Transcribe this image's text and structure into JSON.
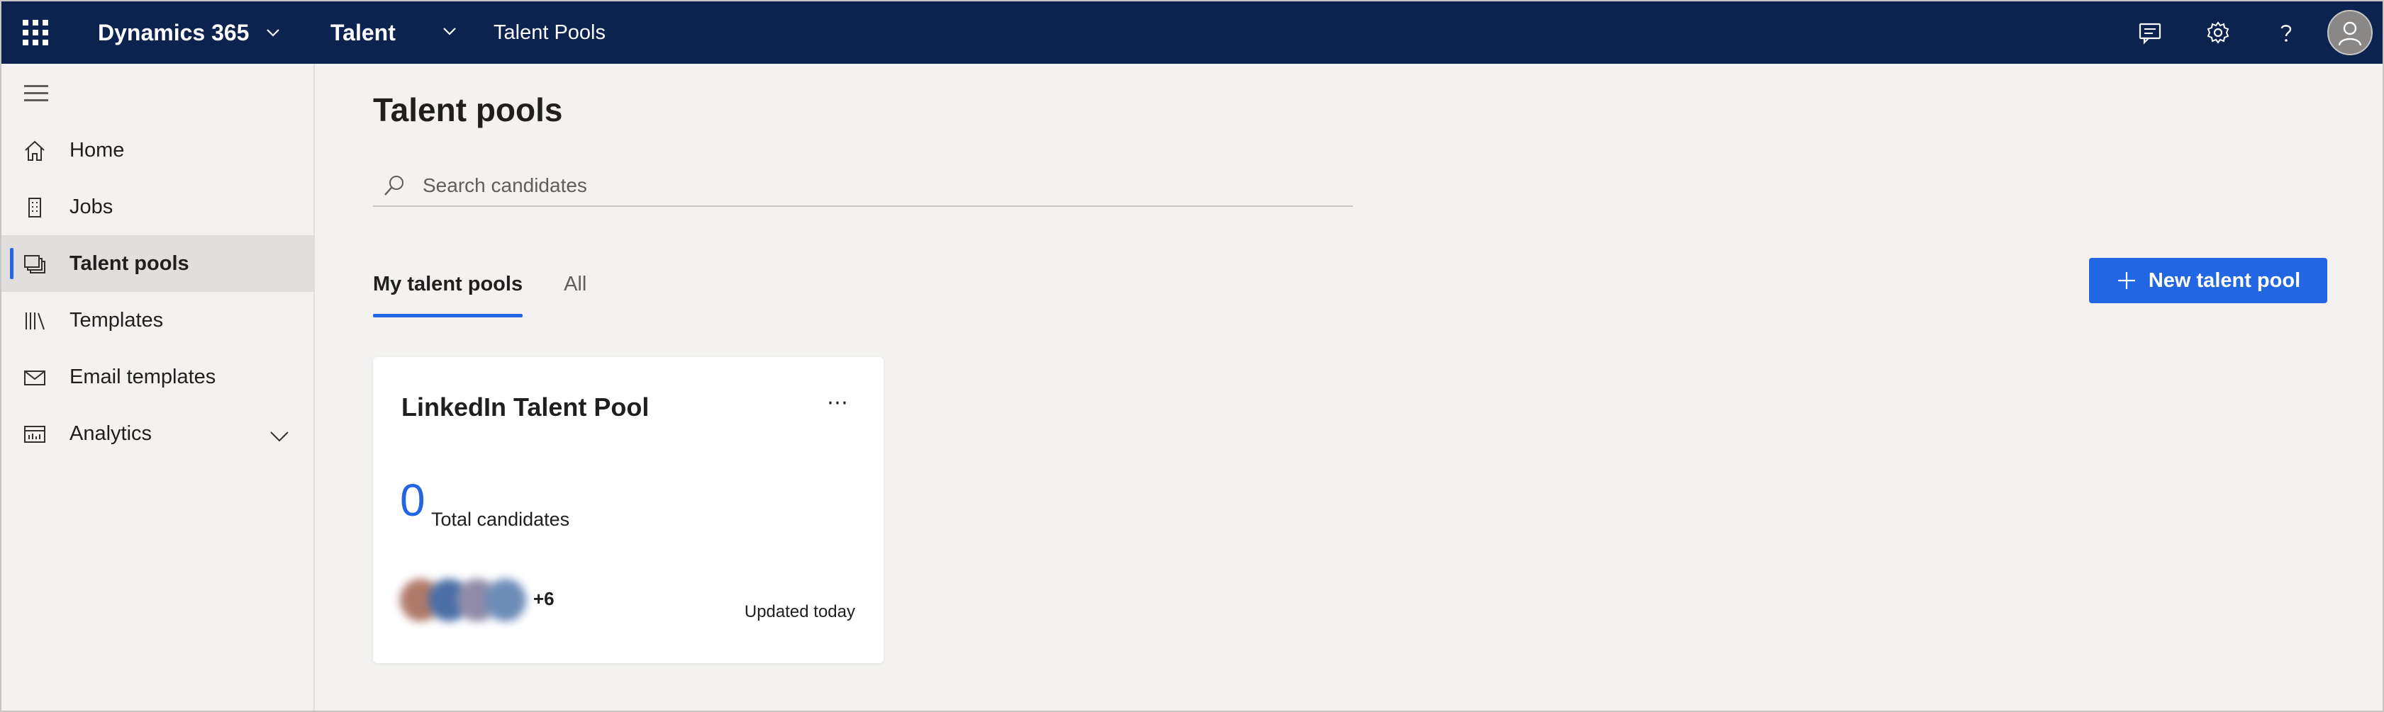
{
  "topbar": {
    "app_suite": "Dynamics 365",
    "app_name": "Talent",
    "breadcrumb": "Talent Pools",
    "bg_color": "#0c2350",
    "icons": [
      "waffle-icon",
      "chevron-down-icon",
      "feedback-icon",
      "gear-icon",
      "help-icon",
      "user-avatar-icon"
    ]
  },
  "sidebar": {
    "items": [
      {
        "label": "Home",
        "icon": "home-icon"
      },
      {
        "label": "Jobs",
        "icon": "building-icon"
      },
      {
        "label": "Talent pools",
        "icon": "talent-pool-icon",
        "active": true
      },
      {
        "label": "Templates",
        "icon": "library-icon"
      },
      {
        "label": "Email templates",
        "icon": "mail-icon"
      },
      {
        "label": "Analytics",
        "icon": "analytics-icon",
        "expandable": true
      }
    ]
  },
  "main": {
    "title": "Talent pools",
    "search": {
      "placeholder": "Search candidates",
      "value": ""
    },
    "tabs": [
      {
        "label": "My talent pools",
        "active": true
      },
      {
        "label": "All",
        "active": false
      }
    ],
    "new_button": "New talent pool",
    "accent_color": "#2266e3",
    "cards": [
      {
        "title": "LinkedIn Talent Pool",
        "count": "0",
        "count_label": "Total candidates",
        "more_members": "+6",
        "updated": "Updated today"
      }
    ]
  }
}
